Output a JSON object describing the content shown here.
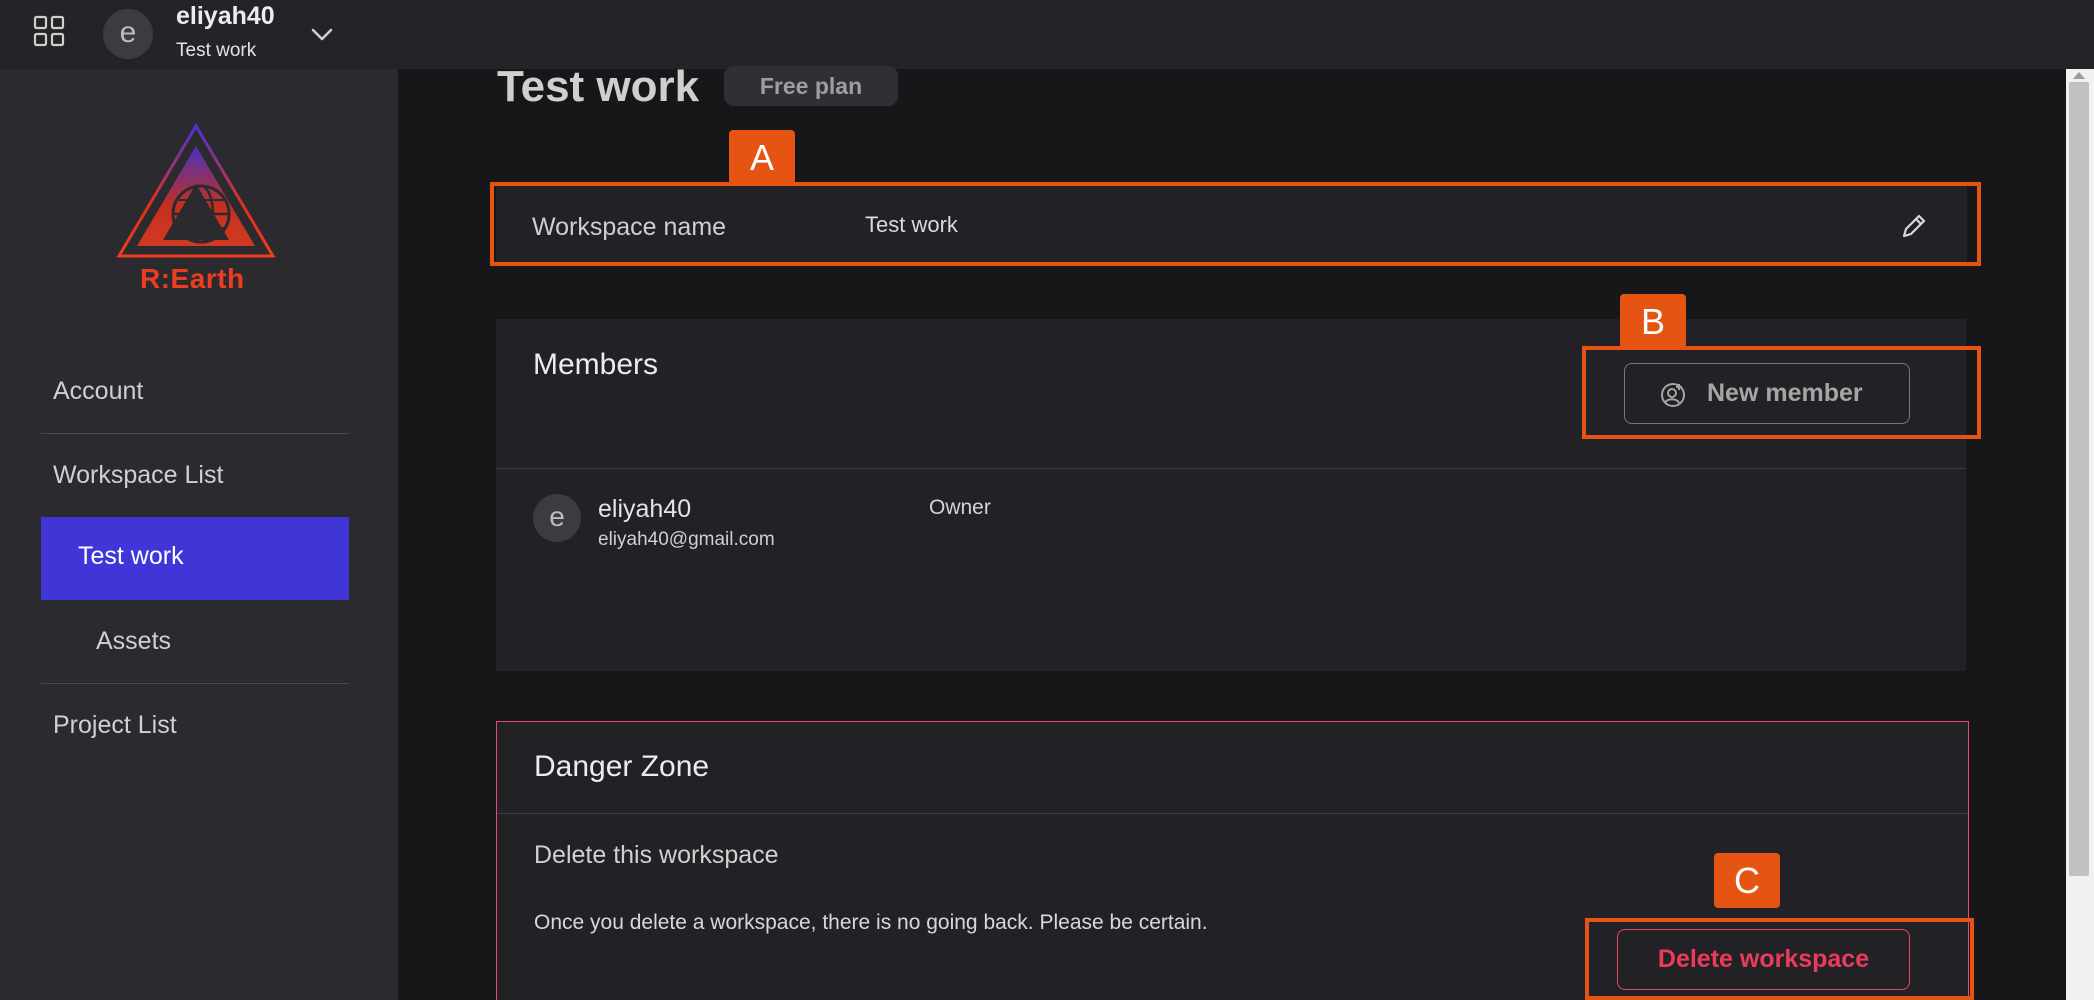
{
  "app": {
    "name": "R:Earth",
    "brand_color": "#ef3c1f",
    "accent_color": "#4036d7",
    "danger_color": "#ea3c5a",
    "annotation_color": "#e65414"
  },
  "topbar": {
    "apps_icon": "grid-icon",
    "avatar_initial": "e",
    "username": "eliyah40",
    "workspace": "Test work",
    "dropdown_icon": "chevron-down-icon"
  },
  "sidebar": {
    "logo_text": "R:Earth",
    "items": [
      {
        "label": "Account",
        "active": false
      },
      {
        "label": "Workspace List",
        "active": false
      },
      {
        "label": "Test work",
        "active": true
      },
      {
        "label": "Assets",
        "active": false
      },
      {
        "label": "Project List",
        "active": false
      }
    ]
  },
  "main": {
    "title": "Test work",
    "plan_badge": "Free plan",
    "workspace_name": {
      "label": "Workspace name",
      "value": "Test work",
      "edit_icon": "pencil-icon"
    },
    "members": {
      "title": "Members",
      "new_member_label": "New member",
      "new_member_icon": "add-user-icon",
      "list": [
        {
          "initial": "e",
          "name": "eliyah40",
          "email": "eliyah40@gmail.com",
          "role": "Owner"
        }
      ]
    },
    "danger_zone": {
      "title": "Danger Zone",
      "subtitle": "Delete this workspace",
      "description": "Once you delete a workspace, there is no going back. Please be certain.",
      "delete_label": "Delete workspace"
    }
  },
  "annotations": [
    {
      "label": "A"
    },
    {
      "label": "B"
    },
    {
      "label": "C"
    }
  ]
}
